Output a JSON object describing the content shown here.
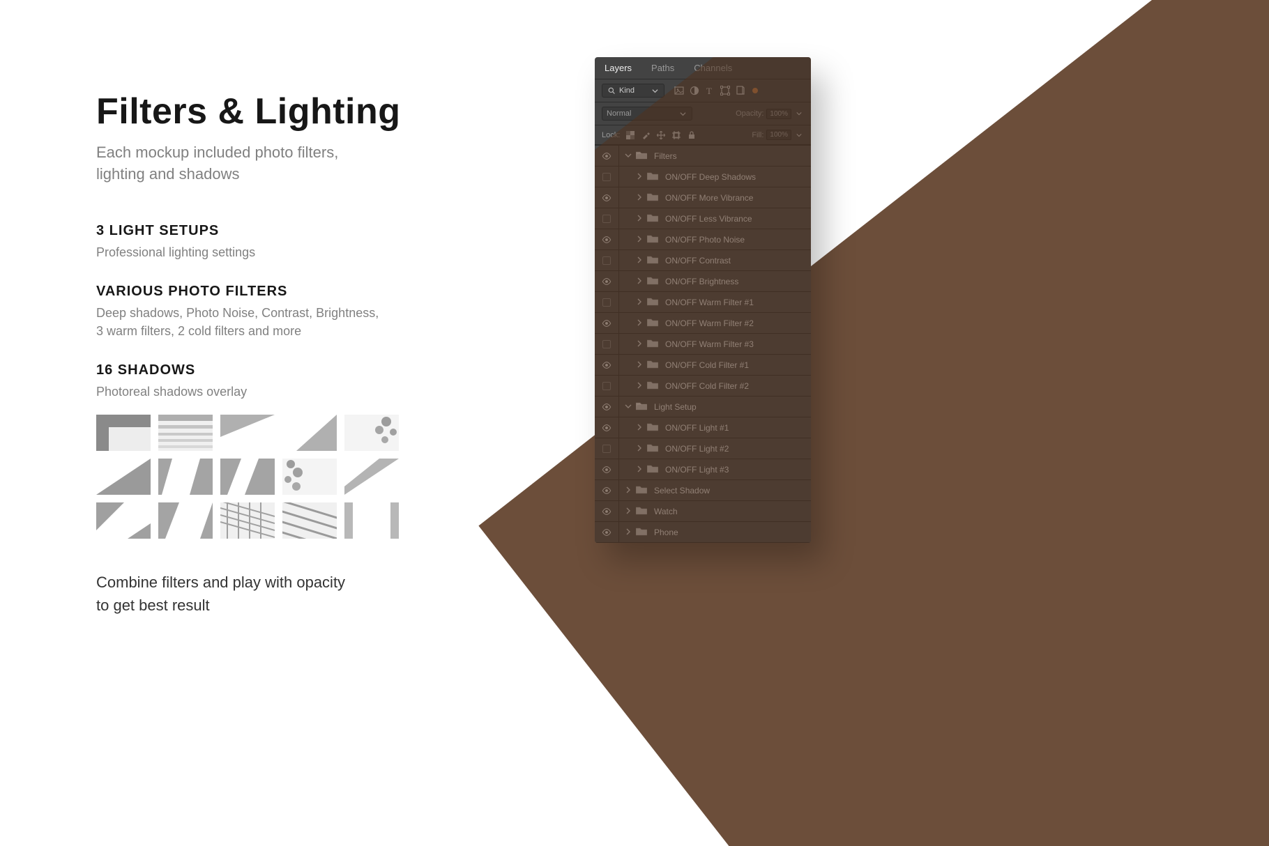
{
  "headline": "Filters & Lighting",
  "subtitle_line1": "Each mockup included photo filters,",
  "subtitle_line2": "lighting and shadows",
  "sections": {
    "light_setups": {
      "heading": "3 LIGHT SETUPS",
      "body": "Professional lighting settings"
    },
    "photo_filters": {
      "heading": "VARIOUS PHOTO FILTERS",
      "body_line1": "Deep shadows, Photo Noise, Contrast, Brightness,",
      "body_line2": "3 warm filters, 2 cold filters and more"
    },
    "shadows": {
      "heading": "16 SHADOWS",
      "body": "Photoreal shadows overlay"
    }
  },
  "closing_line1": "Combine filters and play with opacity",
  "closing_line2": "to get best result",
  "panel": {
    "tabs": {
      "layers": "Layers",
      "paths": "Paths",
      "channels": "Channels"
    },
    "kind_label": "Kind",
    "blend_mode": "Normal",
    "opacity_label": "Opacity:",
    "opacity_value": "100%",
    "lock_label": "Lock:",
    "fill_label": "Fill:",
    "fill_value": "100%",
    "layers": [
      {
        "name": "Filters",
        "indent": 1,
        "visible": true,
        "expanded": true,
        "type": "group"
      },
      {
        "name": "ON/OFF Deep Shadows",
        "indent": 2,
        "visible": false,
        "type": "folder"
      },
      {
        "name": "ON/OFF More Vibrance",
        "indent": 2,
        "visible": true,
        "type": "folder"
      },
      {
        "name": "ON/OFF Less Vibrance",
        "indent": 2,
        "visible": false,
        "type": "folder"
      },
      {
        "name": "ON/OFF Photo Noise",
        "indent": 2,
        "visible": true,
        "type": "folder"
      },
      {
        "name": "ON/OFF Contrast",
        "indent": 2,
        "visible": false,
        "type": "folder"
      },
      {
        "name": "ON/OFF Brightness",
        "indent": 2,
        "visible": true,
        "type": "folder"
      },
      {
        "name": "ON/OFF Warm Filter #1",
        "indent": 2,
        "visible": false,
        "type": "folder"
      },
      {
        "name": "ON/OFF Warm Filter #2",
        "indent": 2,
        "visible": true,
        "type": "folder"
      },
      {
        "name": "ON/OFF Warm Filter #3",
        "indent": 2,
        "visible": false,
        "type": "folder"
      },
      {
        "name": "ON/OFF Cold Filter #1",
        "indent": 2,
        "visible": true,
        "type": "folder"
      },
      {
        "name": "ON/OFF Cold Filter #2",
        "indent": 2,
        "visible": false,
        "type": "folder"
      },
      {
        "name": "Light Setup",
        "indent": 1,
        "visible": true,
        "expanded": true,
        "type": "group"
      },
      {
        "name": "ON/OFF Light #1",
        "indent": 2,
        "visible": true,
        "type": "folder"
      },
      {
        "name": "ON/OFF Light #2",
        "indent": 2,
        "visible": false,
        "type": "folder"
      },
      {
        "name": "ON/OFF Light #3",
        "indent": 2,
        "visible": true,
        "type": "folder"
      },
      {
        "name": "Select Shadow",
        "indent": 1,
        "visible": true,
        "type": "folder"
      },
      {
        "name": "Watch",
        "indent": 1,
        "visible": true,
        "type": "folder"
      },
      {
        "name": "Phone",
        "indent": 1,
        "visible": true,
        "type": "folder"
      }
    ]
  }
}
